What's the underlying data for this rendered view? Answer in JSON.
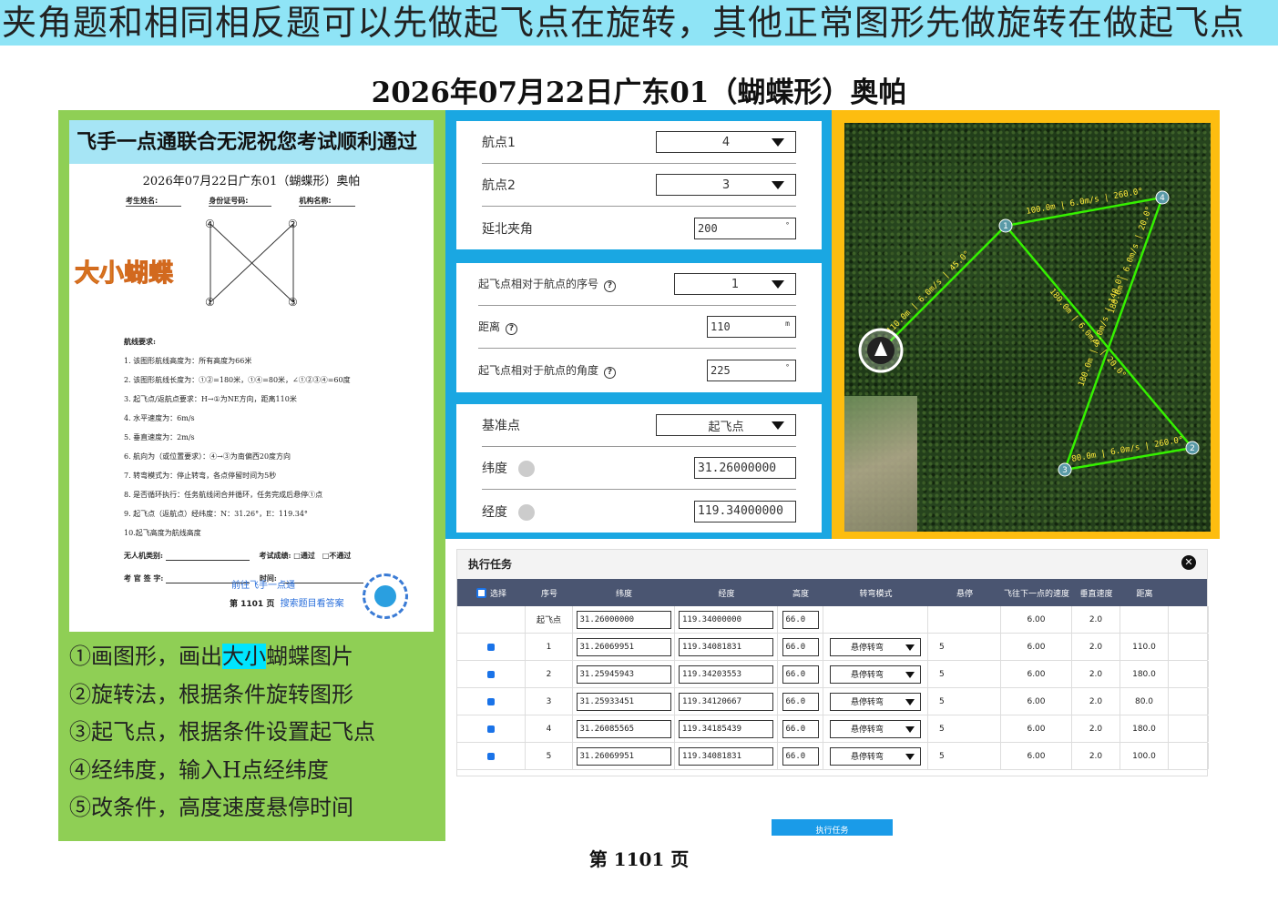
{
  "banner": "夹角题和相同相反题可以先做起飞点在旋转，其他正常图形先做旋转在做起飞点",
  "title": "2026年07月22日广东01（蝴蝶形）奥帕",
  "paper": {
    "banner": "飞手一点通联合无泥祝您考试顺利通过",
    "title": "2026年07月22日广东01（蝴蝶形）奥帕",
    "fields": [
      "考生姓名:",
      "身份证号码:",
      "机构名称:"
    ],
    "big_label": "大小蝴蝶",
    "diagram_labels": [
      "④",
      "②",
      "①",
      "③"
    ],
    "req_head": "航线要求:",
    "requirements": [
      "1. 该图形航线高度为：所有高度为66米",
      "2. 该图形航线长度为：①②=180米，①④=80米，∠①②③④=60度",
      "3. 起飞点/返航点要求：H→①为NE方向，距离110米",
      "4. 水平速度为：6m/s",
      "5. 垂直速度为：2m/s",
      "6. 航向为（或位置要求）：④→③为南偏西20度方向",
      "7. 转弯模式为：停止转弯，各点停留时间为5秒",
      "8. 是否循环执行：任务航线闭合并循环，任务完成后悬停①点",
      "9. 起飞点（返航点）经纬度：N：31.26°，E：119.34°",
      "10.起飞高度为航线高度"
    ],
    "sign1_a": "无人机类别:",
    "sign1_b": "考试成绩:",
    "sign1_c": "□通过　□不通过",
    "sign2_a": "考 官 签 字:",
    "sign2_b": "时间:",
    "qr_line1": "前往飞手一点通",
    "qr_line2": "搜索题目看答案",
    "page": "第 1101 页"
  },
  "steps": {
    "s1_a": "①画图形，画出",
    "s1_hl": "大小",
    "s1_b": "蝴蝶图片",
    "s2": "②旋转法，根据条件旋转图形",
    "s3": "③起飞点，根据条件设置起飞点",
    "s4": "④经纬度，输入H点经纬度",
    "s5": "⑤改条件，高度速度悬停时间"
  },
  "form": {
    "wp1_label": "航点1",
    "wp1_value": "4",
    "wp2_label": "航点2",
    "wp2_value": "3",
    "angle_label": "延北夹角",
    "angle_value": "200",
    "angle_unit": "°",
    "seq_label": "起飞点相对于航点的序号",
    "seq_value": "1",
    "dist_label": "距离",
    "dist_value": "110",
    "dist_unit": "m",
    "rel_angle_label": "起飞点相对于航点的角度",
    "rel_angle_value": "225",
    "rel_angle_unit": "°",
    "base_label": "基准点",
    "base_value": "起飞点",
    "lat_label": "纬度",
    "lat_value": "31.26000000",
    "lon_label": "经度",
    "lon_value": "119.34000000"
  },
  "map": {
    "edges": [
      "100.0m | 6.0m/s | 260.0°",
      "180.0m | 6.0m/s | 20.0°",
      "180.0m | 6.0m/s | 140.0°",
      "80.0m | 6.0m/s | 260.0°",
      "180.0m | 6.0m/s | 20.0°",
      "110.0m | 6.0m/s | 45.0°"
    ],
    "points": [
      "1",
      "2",
      "3",
      "4"
    ]
  },
  "task": {
    "title": "执行任务",
    "close": "✕",
    "headers": [
      "选择",
      "序号",
      "纬度",
      "经度",
      "高度",
      "转弯模式",
      "悬停",
      "飞往下一点的速度",
      "垂直速度",
      "距离"
    ],
    "rows": [
      {
        "seq": "起飞点",
        "lat": "31.26000000",
        "lon": "119.34000000",
        "alt": "66.0",
        "turn": "",
        "hover": "",
        "speed": "6.00",
        "vspeed": "2.0",
        "dist": ""
      },
      {
        "seq": "1",
        "lat": "31.26069951",
        "lon": "119.34081831",
        "alt": "66.0",
        "turn": "悬停转弯",
        "hover": "5",
        "speed": "6.00",
        "vspeed": "2.0",
        "dist": "110.0"
      },
      {
        "seq": "2",
        "lat": "31.25945943",
        "lon": "119.34203553",
        "alt": "66.0",
        "turn": "悬停转弯",
        "hover": "5",
        "speed": "6.00",
        "vspeed": "2.0",
        "dist": "180.0"
      },
      {
        "seq": "3",
        "lat": "31.25933451",
        "lon": "119.34120667",
        "alt": "66.0",
        "turn": "悬停转弯",
        "hover": "5",
        "speed": "6.00",
        "vspeed": "2.0",
        "dist": "80.0"
      },
      {
        "seq": "4",
        "lat": "31.26085565",
        "lon": "119.34185439",
        "alt": "66.0",
        "turn": "悬停转弯",
        "hover": "5",
        "speed": "6.00",
        "vspeed": "2.0",
        "dist": "180.0"
      },
      {
        "seq": "5",
        "lat": "31.26069951",
        "lon": "119.34081831",
        "alt": "66.0",
        "turn": "悬停转弯",
        "hover": "5",
        "speed": "6.00",
        "vspeed": "2.0",
        "dist": "100.0"
      }
    ],
    "exec_label": "执行任务"
  },
  "footer": "第 1101 页",
  "colors": {
    "banner": "#8fe4f6",
    "left_panel": "#8fcf55",
    "mid_panel": "#1aa7e2",
    "map_panel": "#fdbd10",
    "route": "#35f000"
  }
}
